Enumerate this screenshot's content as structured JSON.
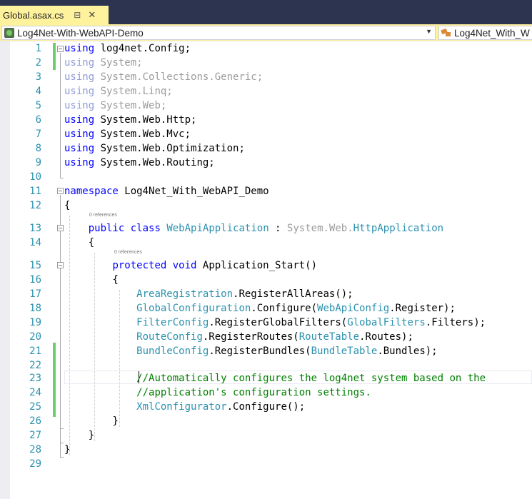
{
  "document_tab": {
    "title": "Global.asax.cs",
    "pin_icon": "pin-icon",
    "close_icon": "close-icon"
  },
  "navigation_bar": {
    "project_dropdown": {
      "value": "Log4Net-With-WebAPI-Demo",
      "icon": "csharp-project-icon"
    },
    "type_dropdown": {
      "value": "Log4Net_With_W",
      "icon": "namespace-class-icon"
    }
  },
  "code_lens": {
    "class_refs": "0 references",
    "method_refs": "0 references"
  },
  "editor": {
    "line_numbers": [
      "1",
      "2",
      "3",
      "4",
      "5",
      "6",
      "7",
      "8",
      "9",
      "10",
      "11",
      "12",
      "13",
      "14",
      "15",
      "16",
      "17",
      "18",
      "19",
      "20",
      "21",
      "22",
      "23",
      "24",
      "25",
      "26",
      "27",
      "28",
      "29"
    ],
    "lines": [
      "using log4net.Config;",
      "using System;",
      "using System.Collections.Generic;",
      "using System.Linq;",
      "using System.Web;",
      "using System.Web.Http;",
      "using System.Web.Mvc;",
      "using System.Web.Optimization;",
      "using System.Web.Routing;",
      "",
      "namespace Log4Net_With_WebAPI_Demo",
      "{",
      "    public class WebApiApplication : System.Web.HttpApplication",
      "    {",
      "        protected void Application_Start()",
      "        {",
      "            AreaRegistration.RegisterAllAreas();",
      "            GlobalConfiguration.Configure(WebApiConfig.Register);",
      "            FilterConfig.RegisterGlobalFilters(GlobalFilters.Filters);",
      "            RouteConfig.RegisterRoutes(RouteTable.Routes);",
      "            BundleConfig.RegisterBundles(BundleTable.Bundles);",
      "",
      "            //Automatically configures the log4net system based on the",
      "            //application's configuration settings.",
      "            XmlConfigurator.Configure();",
      "        }",
      "    }",
      "}",
      ""
    ],
    "tokens": {
      "using": "using",
      "namespace": "namespace",
      "public": "public",
      "class": "class",
      "protected": "protected",
      "void": "void",
      "ns_log4net_config": "log4net.Config;",
      "ns_system": "System;",
      "ns_collections": "System.Collections.Generic;",
      "ns_linq": "System.Linq;",
      "ns_web": "System.Web;",
      "ns_http": "System.Web.Http;",
      "ns_mvc": "System.Web.Mvc;",
      "ns_optimization": "System.Web.Optimization;",
      "ns_routing": "System.Web.Routing;",
      "namespace_name": "Log4Net_With_WebAPI_Demo",
      "open_brace": "{",
      "close_brace": "}",
      "class_name": "WebApiApplication",
      "colon": " : ",
      "base_ns": "System.Web.",
      "base_type": "HttpApplication",
      "method_sig": "Application_Start()",
      "area_reg": "AreaRegistration",
      "area_call": ".RegisterAllAreas();",
      "global_cfg": "GlobalConfiguration",
      "configure_open": ".Configure(",
      "webapi_cfg": "WebApiConfig",
      "register_close": ".Register);",
      "filter_cfg": "FilterConfig",
      "filters_call_open": ".RegisterGlobalFilters(",
      "global_filters": "GlobalFilters",
      "filters_close": ".Filters);",
      "route_cfg": "RouteConfig",
      "routes_call_open": ".RegisterRoutes(",
      "route_table": "RouteTable",
      "routes_close": ".Routes);",
      "bundle_cfg": "BundleConfig",
      "bundles_call_open": ".RegisterBundles(",
      "bundle_table": "BundleTable",
      "bundles_close": ".Bundles);",
      "comment_1": "//Automatically configures the log4net system based on the",
      "comment_2": "//application's configuration settings.",
      "xml_cfg": "XmlConfigurator",
      "xml_call": ".Configure();"
    },
    "syntax_colors": {
      "keyword": "#0000ff",
      "unused_using": "#9b9b9b",
      "type": "#2b91af",
      "comment": "#008000",
      "line_number": "#2b91af",
      "change_marker": "#6cd06a"
    },
    "changed_lines": [
      1,
      2,
      21,
      22,
      23,
      24,
      25
    ],
    "current_line": 23
  }
}
